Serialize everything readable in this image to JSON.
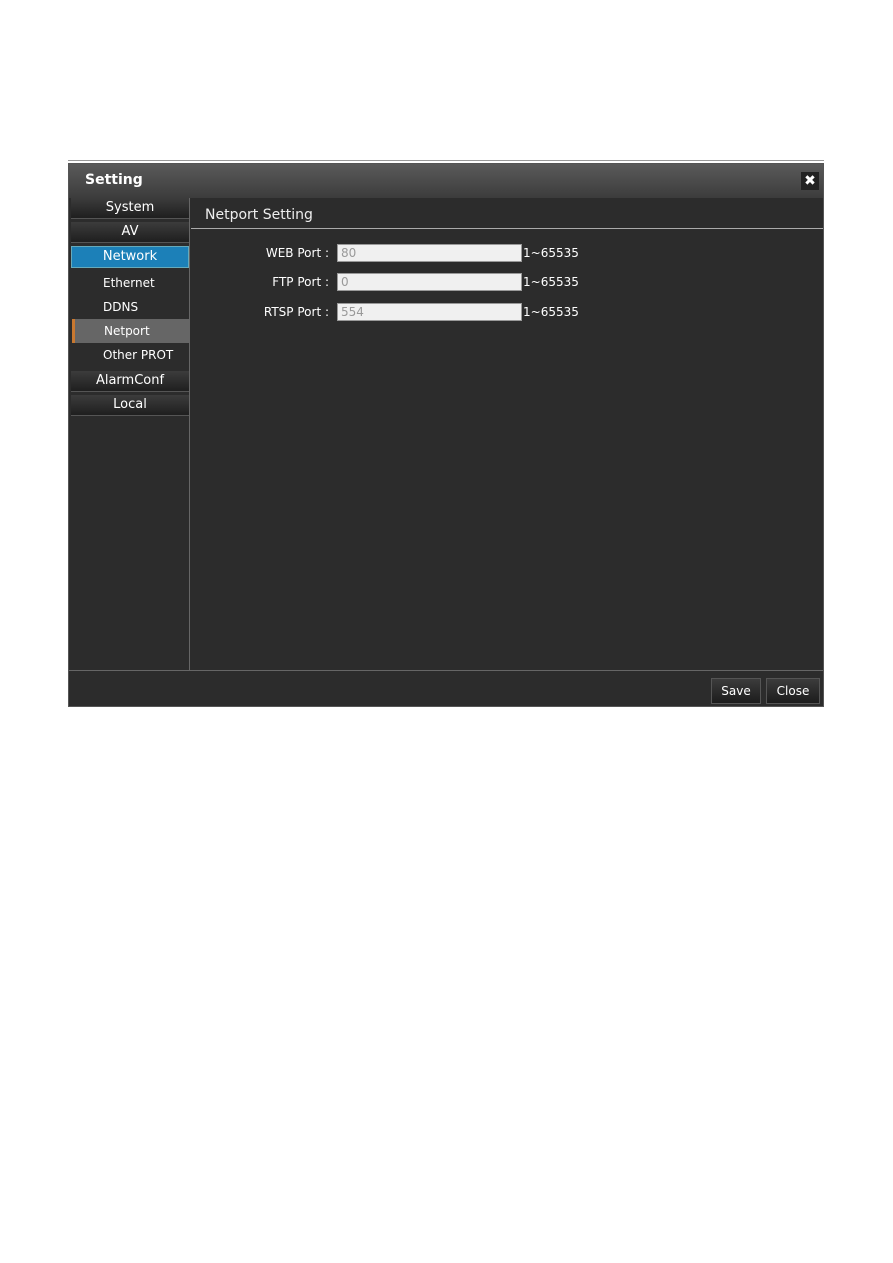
{
  "dialog": {
    "title": "Setting",
    "close_icon": "close-icon"
  },
  "sidebar": {
    "groups": [
      {
        "label": "System"
      },
      {
        "label": "AV"
      },
      {
        "label": "Network",
        "items": [
          "Ethernet",
          "DDNS",
          "Netport",
          "Other PROT"
        ],
        "selected_item": "Netport"
      },
      {
        "label": "AlarmConf"
      },
      {
        "label": "Local"
      }
    ]
  },
  "content": {
    "title": "Netport Setting",
    "fields": [
      {
        "label": "WEB Port :",
        "value": "80",
        "range": "1~65535"
      },
      {
        "label": "FTP Port :",
        "value": "0",
        "range": "1~65535"
      },
      {
        "label": "RTSP Port :",
        "value": "554",
        "range": "1~65535"
      }
    ]
  },
  "footer": {
    "save_label": "Save",
    "close_label": "Close"
  }
}
